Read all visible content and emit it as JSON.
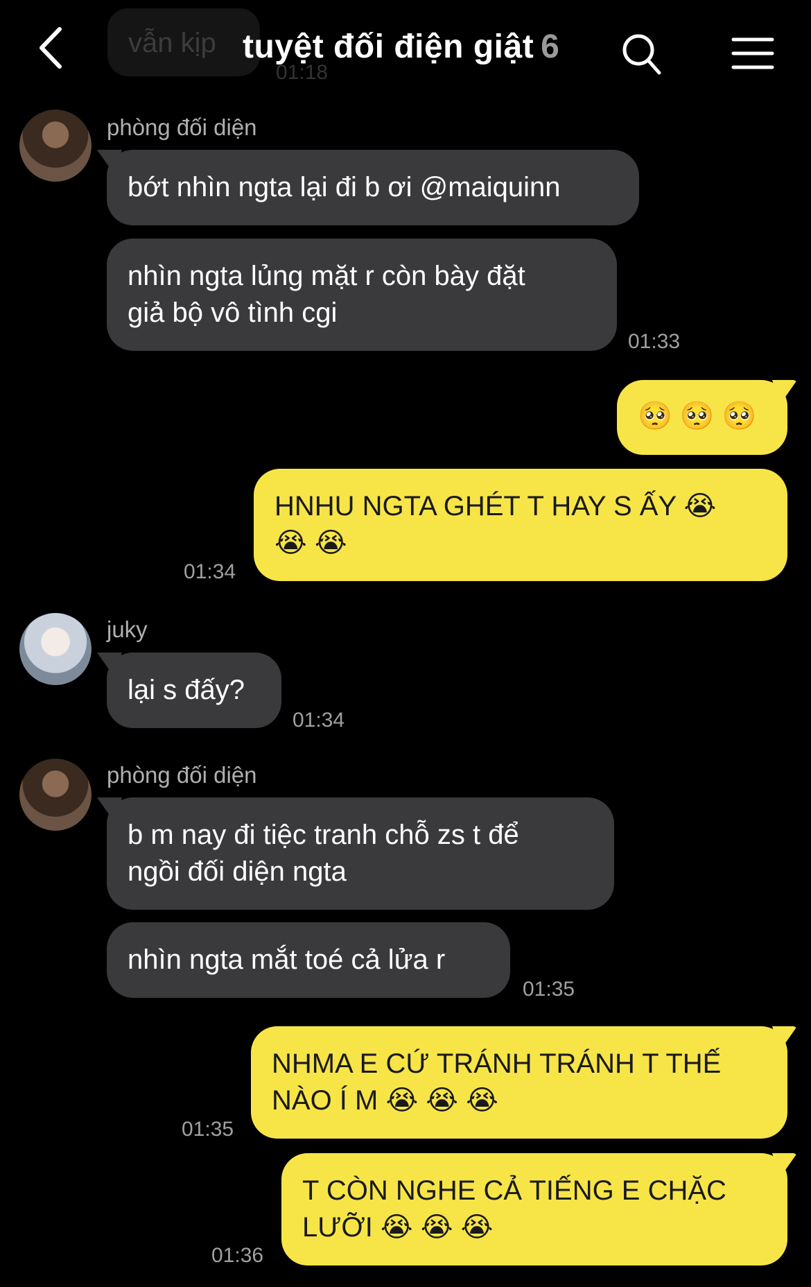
{
  "header": {
    "title": "tuyệt đối điện giật",
    "member_count": "6",
    "behind_bubble_text": "vẫn kịp",
    "behind_bubble_time": "01:18"
  },
  "messages": [
    {
      "sender": "phòng đối diện",
      "text": "bớt nhìn ngta lại đi b ơi @maiquinn"
    },
    {
      "text_line1": "nhìn ngta lủng mặt r còn bày đặt",
      "text_line2": "giả bộ vô tình cgi",
      "time": "01:33"
    },
    {
      "text": "🥺 🥺 🥺"
    },
    {
      "text_line1": "HNHU NGTA GHÉT T HAY S ẤY 😭",
      "text_line2": "😭 😭",
      "time": "01:34"
    },
    {
      "sender": "juky",
      "text": "lại s đấy?",
      "time": "01:34"
    },
    {
      "sender": "phòng đối diện",
      "text_line1": "b m nay đi tiệc tranh chỗ zs t để",
      "text_line2": "ngồi đối diện ngta"
    },
    {
      "text": "nhìn ngta mắt toé cả lửa r",
      "time": "01:35"
    },
    {
      "text_line1": "NHMA E CỨ TRÁNH TRÁNH T THẾ",
      "text_line2": "NÀO Í M 😭 😭 😭",
      "time": "01:35"
    },
    {
      "text_line1": "T CÒN NGHE CẢ TIẾNG E CHẶC",
      "text_line2": "LƯỠI 😭 😭 😭",
      "time": "01:36"
    }
  ],
  "colors": {
    "background": "#000000",
    "incoming_bubble": "#3a3a3c",
    "outgoing_bubble": "#f7e548"
  },
  "icons": [
    "back-chevron-icon",
    "search-icon",
    "menu-icon"
  ]
}
